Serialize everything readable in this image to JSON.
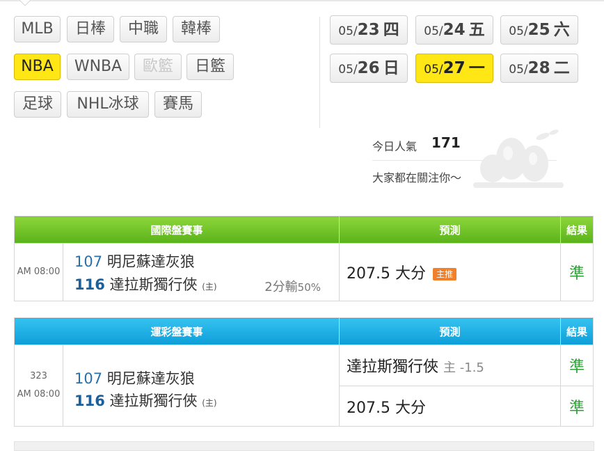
{
  "leagues": [
    {
      "label": "MLB",
      "active": false,
      "disabled": false
    },
    {
      "label": "日棒",
      "active": false,
      "disabled": false
    },
    {
      "label": "中職",
      "active": false,
      "disabled": false
    },
    {
      "label": "韓棒",
      "active": false,
      "disabled": false
    },
    {
      "label": "NBA",
      "active": true,
      "disabled": false
    },
    {
      "label": "WNBA",
      "active": false,
      "disabled": false
    },
    {
      "label": "歐籃",
      "active": false,
      "disabled": true
    },
    {
      "label": "日籃",
      "active": false,
      "disabled": false
    },
    {
      "label": "足球",
      "active": false,
      "disabled": false
    },
    {
      "label": "NHL冰球",
      "active": false,
      "disabled": false
    },
    {
      "label": "賽馬",
      "active": false,
      "disabled": false
    }
  ],
  "dates": [
    {
      "month": "05/",
      "day": "23",
      "weekday": "四",
      "active": false
    },
    {
      "month": "05/",
      "day": "24",
      "weekday": "五",
      "active": false
    },
    {
      "month": "05/",
      "day": "25",
      "weekday": "六",
      "active": false
    },
    {
      "month": "05/",
      "day": "26",
      "weekday": "日",
      "active": false
    },
    {
      "month": "05/",
      "day": "27",
      "weekday": "一",
      "active": true
    },
    {
      "month": "05/",
      "day": "28",
      "weekday": "二",
      "active": false
    }
  ],
  "popularity": {
    "label": "今日人氣",
    "value": "171",
    "message": "大家都在關注你〜"
  },
  "intl": {
    "header": {
      "match": "國際盤賽事",
      "prediction": "預測",
      "result": "結果"
    },
    "time": "AM 08:00",
    "away": {
      "score": "107",
      "name": "明尼蘇達灰狼"
    },
    "home": {
      "score": "116",
      "name": "達拉斯獨行俠",
      "tag": "(主)"
    },
    "loss_note": "2分輸",
    "loss_pct": "50%",
    "prediction": "207.5 大分",
    "badge": "主推",
    "result": "準"
  },
  "sports": {
    "header": {
      "match": "運彩盤賽事",
      "prediction": "預測",
      "result": "結果"
    },
    "game_no": "323",
    "time": "AM 08:00",
    "away": {
      "score": "107",
      "name": "明尼蘇達灰狼"
    },
    "home": {
      "score": "116",
      "name": "達拉斯獨行俠",
      "tag": "(主)"
    },
    "pred1": {
      "team": "達拉斯獨行俠",
      "side": "主 -1.5",
      "result": "準"
    },
    "pred2": {
      "text": "207.5 大分",
      "result": "準"
    }
  },
  "colors": {
    "active": "#ffe615",
    "green_header": "#5ab21a",
    "blue_header": "#0e9ed8",
    "hit": "#2f9e3a",
    "badge": "#f2802b"
  }
}
